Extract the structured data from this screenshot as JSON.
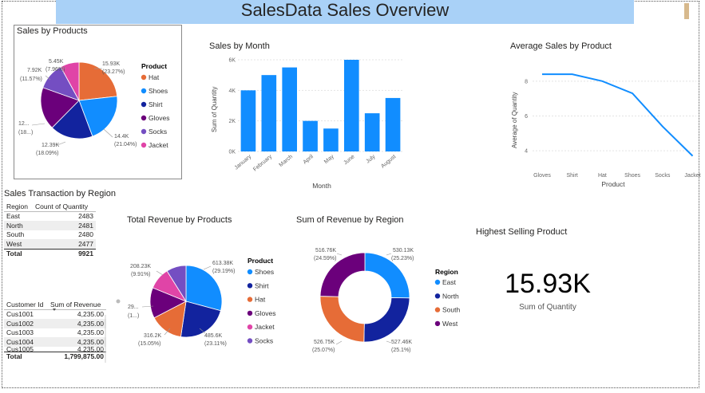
{
  "page": {
    "title": "SalesData Sales Overview"
  },
  "colors": {
    "orange": "#E66C37",
    "blue": "#118DFF",
    "navy": "#12239E",
    "purple": "#6B007B",
    "violet": "#744EC2",
    "pink": "#E044A7",
    "banner": "#A9D1F7"
  },
  "visuals": {
    "sales_by_products": {
      "title": "Sales by Products",
      "legend_title": "Product",
      "legend": [
        "Hat",
        "Shoes",
        "Shirt",
        "Gloves",
        "Socks",
        "Jacket"
      ],
      "labels": [
        [
          "15.93K",
          "(23.27%)"
        ],
        [
          "14.4K",
          "(21.04%)"
        ],
        [
          "12.39K",
          "(18.09%)"
        ],
        [
          "12...",
          "(18...)"
        ],
        [
          "7.92K",
          "(11.57%)"
        ],
        [
          "5.45K",
          "(7.96%)"
        ]
      ]
    },
    "sales_by_month": {
      "title": "Sales by Month",
      "xlabel": "Month",
      "ylabel": "Sum of Quantity"
    },
    "avg_sales_by_product": {
      "title": "Average Sales by Product",
      "xlabel": "Product",
      "ylabel": "Average of Quantity"
    },
    "transactions_by_region": {
      "title": "Sales Transaction by Region",
      "headers": [
        "Region",
        "Count of Quantity"
      ],
      "rows": [
        [
          "East",
          "2483"
        ],
        [
          "North",
          "2481"
        ],
        [
          "South",
          "2480"
        ],
        [
          "West",
          "2477"
        ]
      ],
      "total": [
        "Total",
        "9921"
      ]
    },
    "customer_table": {
      "headers": [
        "Customer Id",
        "Sum of Revenue"
      ],
      "rows": [
        [
          "Cus1001",
          "4,235.00"
        ],
        [
          "Cus1002",
          "4,235.00"
        ],
        [
          "Cus1003",
          "4,235.00"
        ],
        [
          "Cus1004",
          "4,235.00"
        ],
        [
          "Cus1005",
          "4,235.00"
        ]
      ],
      "total": [
        "Total",
        "1,799,875.00"
      ]
    },
    "revenue_by_products": {
      "title": "Total Revenue by Products",
      "legend_title": "Product",
      "legend": [
        "Shoes",
        "Shirt",
        "Hat",
        "Gloves",
        "Jacket",
        "Socks"
      ],
      "labels": [
        [
          "613.38K",
          "(29.19%)"
        ],
        [
          "485.6K",
          "(23.11%)"
        ],
        [
          "316.2K",
          "(15.05%)"
        ],
        [
          "29...",
          "(1...)"
        ],
        [
          "208.23K",
          "(9.91%)"
        ]
      ]
    },
    "revenue_by_region": {
      "title": "Sum of Revenue by Region",
      "legend_title": "Region",
      "legend": [
        "East",
        "North",
        "South",
        "West"
      ],
      "labels": [
        [
          "530.13K",
          "(25.23%)"
        ],
        [
          "527.46K",
          "(25.1%)"
        ],
        [
          "526.75K",
          "(25.07%)"
        ],
        [
          "516.76K",
          "(24.59%)"
        ]
      ]
    },
    "highest_selling": {
      "title": "Highest Selling Product",
      "value": "15.93K",
      "label": "Sum of Quantity"
    }
  },
  "chart_data": [
    {
      "id": "sales_by_products",
      "type": "pie",
      "title": "Sales by Products",
      "categories": [
        "Hat",
        "Shoes",
        "Shirt",
        "Gloves",
        "Socks",
        "Jacket"
      ],
      "values": [
        15930,
        14400,
        12390,
        12380,
        7920,
        5450
      ],
      "colors": [
        "#E66C37",
        "#118DFF",
        "#12239E",
        "#6B007B",
        "#744EC2",
        "#E044A7"
      ]
    },
    {
      "id": "sales_by_month",
      "type": "bar",
      "title": "Sales by Month",
      "categories": [
        "January",
        "February",
        "March",
        "April",
        "May",
        "June",
        "July",
        "August"
      ],
      "values": [
        4000,
        5000,
        5500,
        2000,
        1500,
        6000,
        2500,
        3500
      ],
      "xlabel": "Month",
      "ylabel": "Sum of Quantity",
      "ylim": [
        0,
        6000
      ],
      "yticks": [
        0,
        2000,
        4000,
        6000
      ],
      "ytick_labels": [
        "0K",
        "2K",
        "4K",
        "6K"
      ],
      "grid": true,
      "color": "#118DFF"
    },
    {
      "id": "avg_sales_by_product",
      "type": "line",
      "title": "Average Sales by Product",
      "categories": [
        "Gloves",
        "Shirt",
        "Hat",
        "Shoes",
        "Socks",
        "Jacket"
      ],
      "values": [
        8.4,
        8.4,
        8.0,
        7.3,
        5.4,
        3.7
      ],
      "xlabel": "Product",
      "ylabel": "Average of Quantity",
      "ylim": [
        3.5,
        9
      ],
      "yticks": [
        4,
        6,
        8
      ],
      "grid": true,
      "color": "#118DFF"
    },
    {
      "id": "revenue_by_products",
      "type": "pie",
      "title": "Total Revenue by Products",
      "categories": [
        "Shoes",
        "Shirt",
        "Hat",
        "Gloves",
        "Jacket",
        "Socks"
      ],
      "values": [
        613380,
        485600,
        316200,
        290000,
        208230,
        187000
      ],
      "colors": [
        "#118DFF",
        "#12239E",
        "#E66C37",
        "#6B007B",
        "#E044A7",
        "#744EC2"
      ]
    },
    {
      "id": "revenue_by_region",
      "type": "pie",
      "donut": true,
      "title": "Sum of Revenue by Region",
      "categories": [
        "East",
        "North",
        "South",
        "West"
      ],
      "values": [
        530130,
        527460,
        526750,
        516760
      ],
      "colors": [
        "#118DFF",
        "#12239E",
        "#E66C37",
        "#6B007B"
      ]
    }
  ]
}
